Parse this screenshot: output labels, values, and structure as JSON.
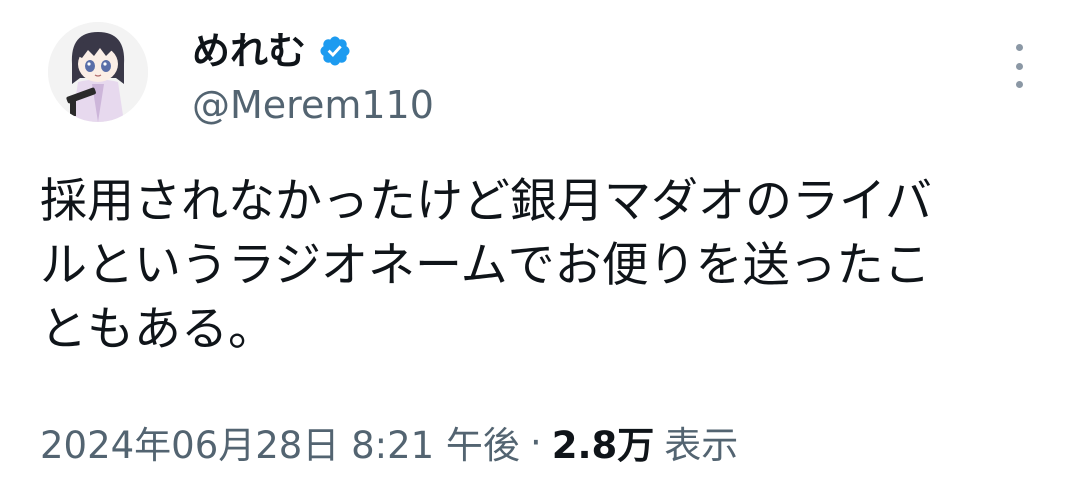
{
  "author": {
    "display_name": "めれむ",
    "handle": "@Merem110",
    "verified": true,
    "avatar_icon": "anime-character-avatar-icon",
    "verified_icon": "verified-badge-icon"
  },
  "tweet": {
    "text_lines": [
      "採用されなかったけど銀月マダオのライバ",
      "ルというラジオネームでお便りを送ったこ",
      "ともある。"
    ]
  },
  "meta": {
    "date_time": "2024年06月28日 8:21 午後",
    "separator": "·",
    "views_count": "2.8万",
    "views_label": "表示"
  },
  "menu": {
    "more_icon": "more-vertical-icon"
  },
  "colors": {
    "text_primary": "#0f1419",
    "text_secondary": "#536471",
    "verified_blue": "#1d9bf0",
    "more_dots": "#8b98a5"
  }
}
